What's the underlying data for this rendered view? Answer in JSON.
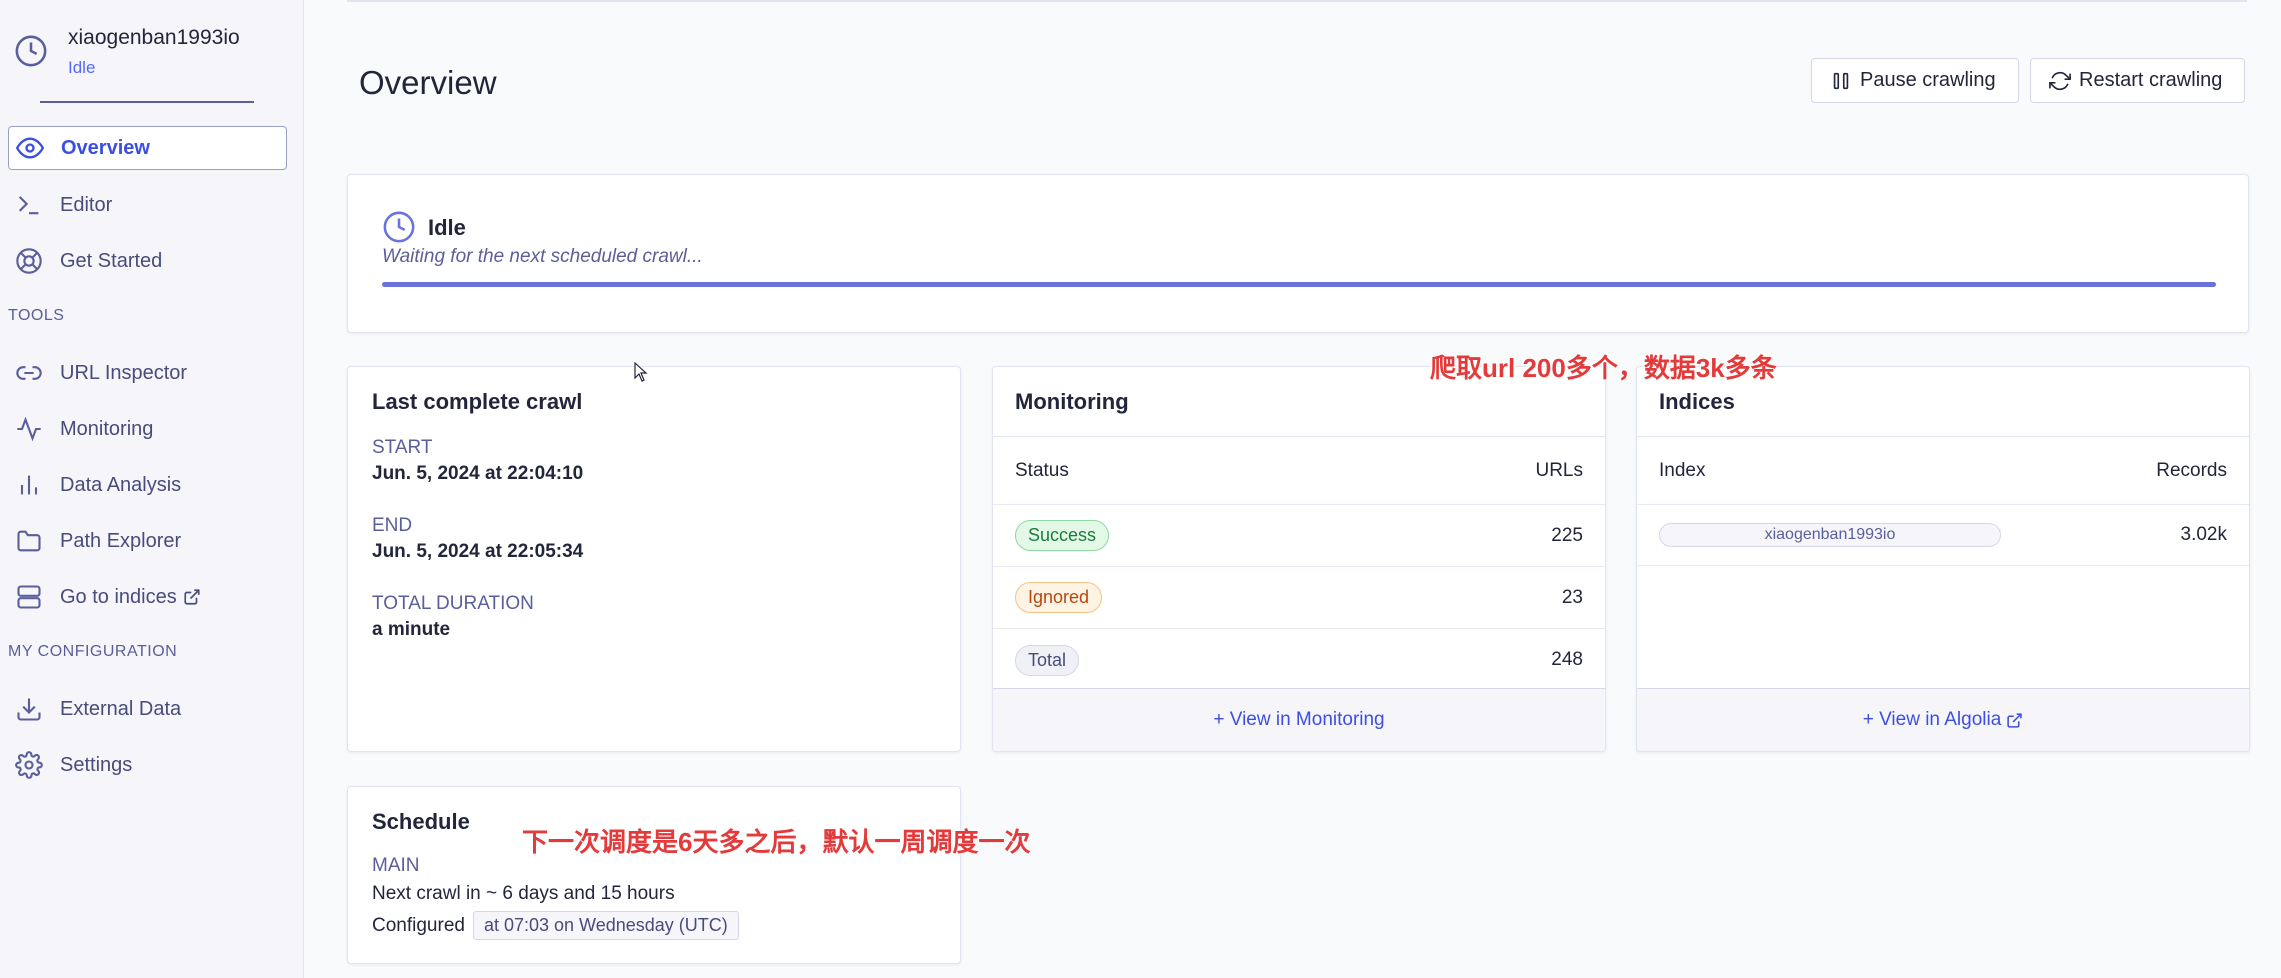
{
  "sidebar": {
    "crawler_name": "xiaogenban1993io",
    "crawler_status": "Idle",
    "items": [
      {
        "label": "Overview",
        "icon": "eye-icon"
      },
      {
        "label": "Editor",
        "icon": "terminal-icon"
      },
      {
        "label": "Get Started",
        "icon": "lifebuoy-icon"
      }
    ],
    "tools_label": "TOOLS",
    "tools": [
      {
        "label": "URL Inspector",
        "icon": "link-icon"
      },
      {
        "label": "Monitoring",
        "icon": "activity-icon"
      },
      {
        "label": "Data Analysis",
        "icon": "bar-chart-icon"
      },
      {
        "label": "Path Explorer",
        "icon": "folder-icon"
      },
      {
        "label": "Go to indices",
        "icon": "server-icon"
      }
    ],
    "config_label": "MY CONFIGURATION",
    "config": [
      {
        "label": "External Data",
        "icon": "download-icon"
      },
      {
        "label": "Settings",
        "icon": "gear-icon"
      }
    ]
  },
  "header": {
    "title": "Overview",
    "pause_label": "Pause crawling",
    "restart_label": "Restart crawling"
  },
  "status_card": {
    "title": "Idle",
    "subtitle": "Waiting for the next scheduled crawl...",
    "progress": 1.0,
    "accent": "#6a72e0"
  },
  "last_crawl": {
    "title": "Last complete crawl",
    "start_label": "START",
    "start_value": "Jun. 5, 2024 at 22:04:10",
    "end_label": "END",
    "end_value": "Jun. 5, 2024 at 22:05:34",
    "duration_label": "TOTAL DURATION",
    "duration_value": "a minute"
  },
  "monitoring": {
    "title": "Monitoring",
    "col_status": "Status",
    "col_urls": "URLs",
    "rows": [
      {
        "status": "Success",
        "count": "225"
      },
      {
        "status": "Ignored",
        "count": "23"
      },
      {
        "status": "Total",
        "count": "248"
      }
    ],
    "footer": "+ View in Monitoring"
  },
  "indices": {
    "title": "Indices",
    "col_index": "Index",
    "col_records": "Records",
    "rows": [
      {
        "index": "xiaogenban1993io",
        "records": "3.02k"
      }
    ],
    "footer": "+ View in Algolia"
  },
  "schedule": {
    "title": "Schedule",
    "main_label": "MAIN",
    "next_crawl": "Next crawl in ~ 6 days and 15 hours",
    "configured_label": "Configured",
    "configured_value": "at 07:03 on Wednesday (UTC)"
  },
  "annotations": {
    "top": "爬取url 200多个，数据3k多条",
    "bottom": "下一次调度是6天多之后，默认一周调度一次"
  }
}
